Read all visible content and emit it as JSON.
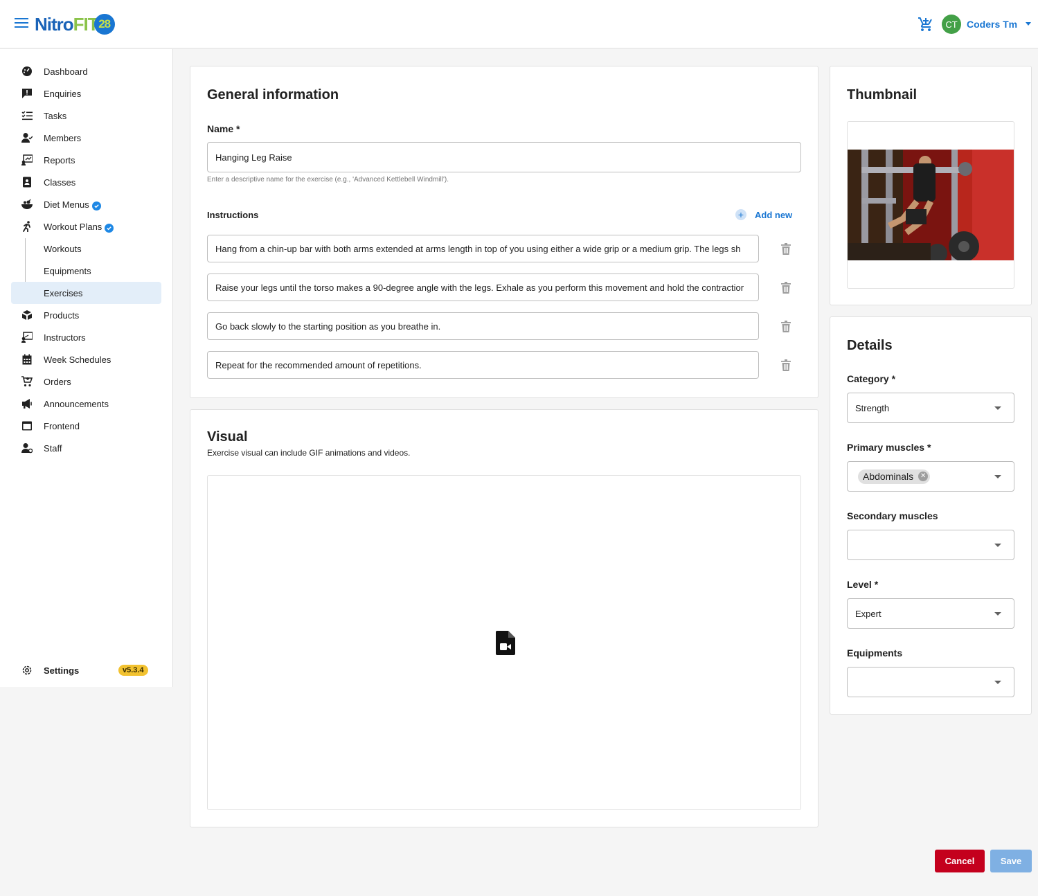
{
  "header": {
    "logo_nitro": "Nitro",
    "logo_fit": "FIT",
    "logo_num": "28",
    "user_initials": "CT",
    "user_name": "Coders Tm"
  },
  "sidebar": {
    "items": [
      {
        "label": "Dashboard",
        "icon": "dashboard-icon"
      },
      {
        "label": "Enquiries",
        "icon": "chat-icon"
      },
      {
        "label": "Tasks",
        "icon": "checklist-icon"
      },
      {
        "label": "Members",
        "icon": "members-icon"
      },
      {
        "label": "Reports",
        "icon": "reports-icon"
      },
      {
        "label": "Classes",
        "icon": "classes-icon"
      },
      {
        "label": "Diet Menus",
        "icon": "diet-icon"
      },
      {
        "label": "Workout Plans",
        "icon": "workout-icon"
      },
      {
        "label": "Workouts"
      },
      {
        "label": "Equipments"
      },
      {
        "label": "Exercises"
      },
      {
        "label": "Products",
        "icon": "products-icon"
      },
      {
        "label": "Instructors",
        "icon": "instructor-icon"
      },
      {
        "label": "Week Schedules",
        "icon": "calendar-icon"
      },
      {
        "label": "Orders",
        "icon": "cart-icon"
      },
      {
        "label": "Announcements",
        "icon": "megaphone-icon"
      },
      {
        "label": "Frontend",
        "icon": "browser-icon"
      },
      {
        "label": "Staff",
        "icon": "staff-icon"
      }
    ],
    "active": "Exercises",
    "settings_label": "Settings",
    "version": "v5.3.4"
  },
  "general": {
    "title": "General information",
    "name_label": "Name *",
    "name_value": "Hanging Leg Raise",
    "name_helper": "Enter a descriptive name for the exercise (e.g., 'Advanced Kettlebell Windmill').",
    "instructions_label": "Instructions",
    "add_new_label": "Add new",
    "instructions": [
      "Hang from a chin-up bar with both arms extended at arms length in top of you using either a wide grip or a medium grip. The legs sh",
      "Raise your legs until the torso makes a 90-degree angle with the legs. Exhale as you perform this movement and hold the contractior",
      "Go back slowly to the starting position as you breathe in.",
      "Repeat for the recommended amount of repetitions."
    ]
  },
  "visual": {
    "title": "Visual",
    "description": "Exercise visual can include GIF animations and videos."
  },
  "thumbnail": {
    "title": "Thumbnail"
  },
  "details": {
    "title": "Details",
    "category_label": "Category *",
    "category_value": "Strength",
    "primary_label": "Primary muscles *",
    "primary_chip": "Abdominals",
    "secondary_label": "Secondary muscles",
    "level_label": "Level *",
    "level_value": "Expert",
    "equipments_label": "Equipments"
  },
  "actions": {
    "cancel_label": "Cancel",
    "save_label": "Save"
  },
  "colors": {
    "primary": "#1976d2",
    "cancel": "#c4001d",
    "save_disabled": "#7fb0e3",
    "version_badge": "#f2c230"
  }
}
